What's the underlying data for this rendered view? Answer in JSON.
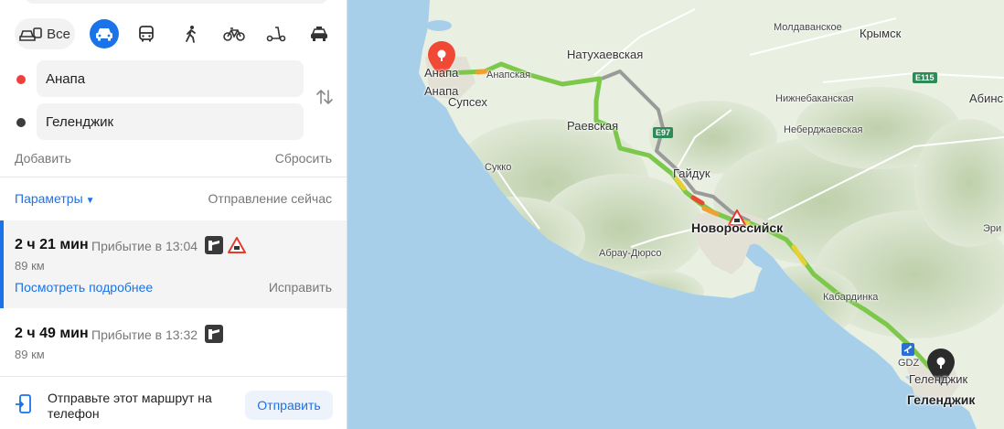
{
  "modes": {
    "all_label": "Все"
  },
  "route_points": {
    "from": "Анапа",
    "to": "Геленджик"
  },
  "actions": {
    "add": "Добавить",
    "reset": "Сбросить"
  },
  "params": {
    "label": "Параметры",
    "departure": "Отправление сейчас"
  },
  "routes": [
    {
      "time": "2 ч 21 мин",
      "arrival": "Прибытие в 13:04",
      "distance": "89 км",
      "details": "Посмотреть подробнее",
      "fix": "Исправить"
    },
    {
      "time": "2 ч 49 мин",
      "arrival": "Прибытие в 13:32",
      "distance": "89 км"
    }
  ],
  "send": {
    "text": "Отправьте этот маршрут на телефон",
    "button": "Отправить"
  },
  "map": {
    "labels": {
      "moldavanskoe": "Молдаванское",
      "krymsk": "Крымск",
      "natukhaevskaya": "Натухаевская",
      "anapa_pin": "Анапа",
      "anapa": "Анапа",
      "anapskaya": "Анапская",
      "supsekh": "Супсех",
      "raevskaya": "Раевская",
      "sukko": "Сукко",
      "gaiduk": "Гайдук",
      "novorossiysk": "Новороссийск",
      "abrau": "Абрау-Дюрсо",
      "nizhnebakanskaya": "Нижнебаканская",
      "neberdzhaevskaya": "Неберджаевская",
      "kabardinka": "Кабардинка",
      "gdz": "GDZ",
      "gelendzhik_pin": "Геленджик",
      "gelendzhik": "Геленджик",
      "abinsk": "Абинс",
      "erik": "Эри"
    },
    "shields": {
      "e115": "E115",
      "e97": "E97"
    },
    "colors": {
      "sea": "#a8cfea",
      "land": "#e9efe1",
      "route_main": "#7cc84a",
      "route_alt": "#9a9a9a",
      "pin_start": "#f04a36",
      "pin_end": "#2b2b2b"
    }
  }
}
